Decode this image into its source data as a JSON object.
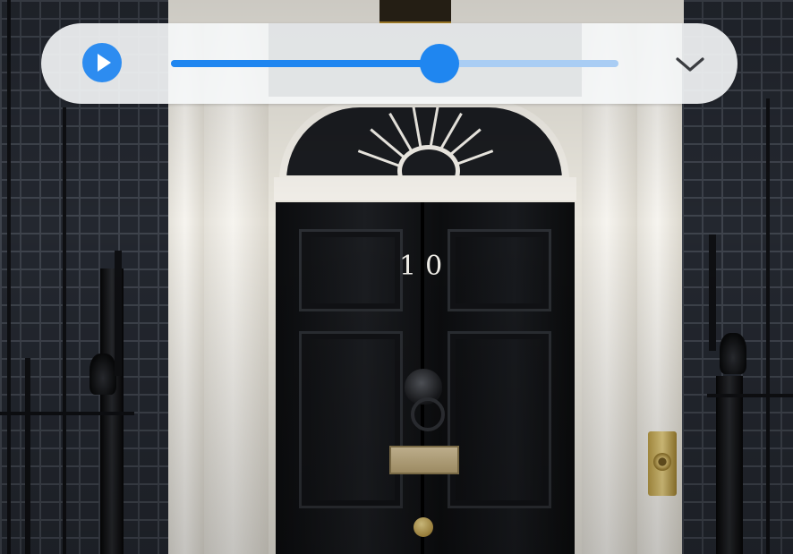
{
  "photo": {
    "door_number": "10",
    "door_color": "#0d0e10",
    "brick_color": "#23272f",
    "stone_color": "#efece4",
    "brass_color": "#c9a552"
  },
  "player": {
    "state": "paused",
    "progress": 0.6,
    "accent_color": "#1f86f0",
    "track_color": "#a9cdf4",
    "icons": [
      "play-icon",
      "chevron-down-icon"
    ]
  }
}
